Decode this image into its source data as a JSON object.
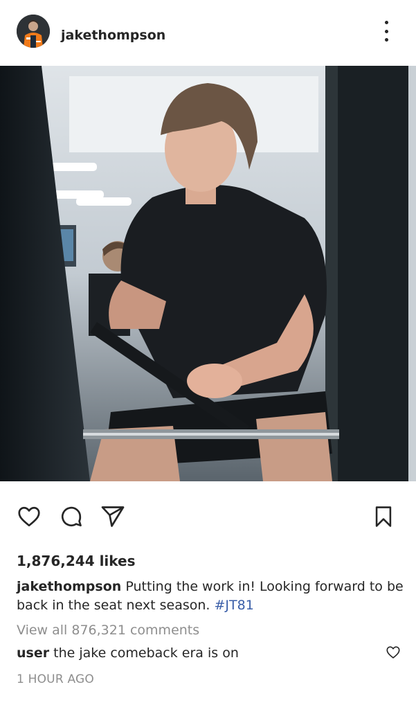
{
  "post": {
    "username": "jakethompson",
    "more_icon": "more-vertical-icon",
    "photo_description_icon": "post-photo"
  },
  "actions": {
    "like_icon": "heart-icon",
    "comment_icon": "comment-icon",
    "share_icon": "send-icon",
    "save_icon": "bookmark-icon"
  },
  "likes_text": "1,876,244 likes",
  "caption": {
    "username": "jakethompson",
    "text": " Putting the work in! Looking forward to be back in the seat next season. ",
    "hashtag": "#JT81"
  },
  "view_all_comments": "View all 876,321 comments",
  "comment": {
    "username": "user",
    "text": " the jake comeback era is on"
  },
  "timestamp": "1 HOUR AGO",
  "colors": {
    "hashtag": "#3a5ea8",
    "muted": "#8e8e8e",
    "text": "#262626"
  }
}
